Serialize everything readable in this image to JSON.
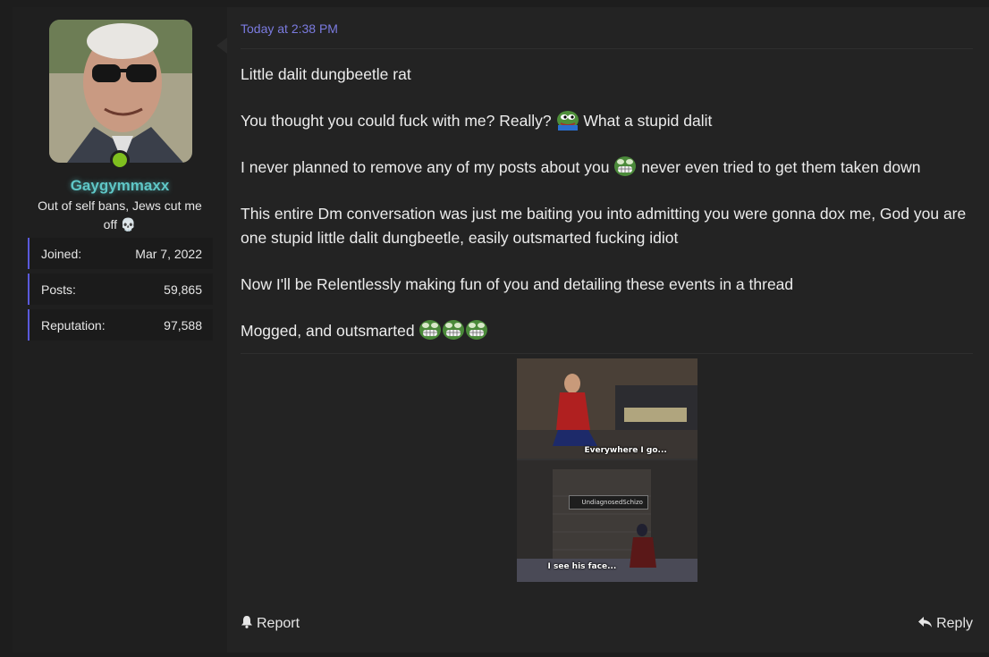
{
  "user": {
    "username": "Gaygymmaxx",
    "title": "Out of self bans, Jews cut me off 💀",
    "stats": [
      {
        "label": "Joined:",
        "value": "Mar 7, 2022"
      },
      {
        "label": "Posts:",
        "value": "59,865"
      },
      {
        "label": "Reputation:",
        "value": "97,588"
      }
    ],
    "online": true
  },
  "post": {
    "timestamp": "Today at 2:38 PM",
    "paragraphs": {
      "p1": "Little dalit dungbeetle rat",
      "p2a": "You thought you could fuck with me? Really?",
      "p2b": "What a stupid dalit",
      "p3a": "I never planned to remove any of my posts about you",
      "p3b": "never even tried to get them taken down",
      "p4": "This entire Dm conversation was just me baiting you into admitting you were gonna dox me, God you are one stupid little dalit dungbeetle, easily outsmarted fucking idiot",
      "p5": "Now I'll be Relentlessly making fun of you and detailing these events in a thread",
      "p6": "Mogged, and outsmarted"
    },
    "meme": {
      "caption_top": "Everywhere I go...",
      "tag": "UndiagnosedSchizo",
      "caption_bottom": "I see his face..."
    }
  },
  "actions": {
    "report_label": "Report",
    "reply_label": "Reply"
  },
  "icons": {
    "report": "bell-icon",
    "reply": "reply-icon",
    "emoji": "pepe-emoji-icon"
  },
  "colors": {
    "username": "#5fc7c7",
    "timestamp": "#7b7be0",
    "stat_accent": "#5a5adb",
    "online": "#7fbf1f"
  }
}
